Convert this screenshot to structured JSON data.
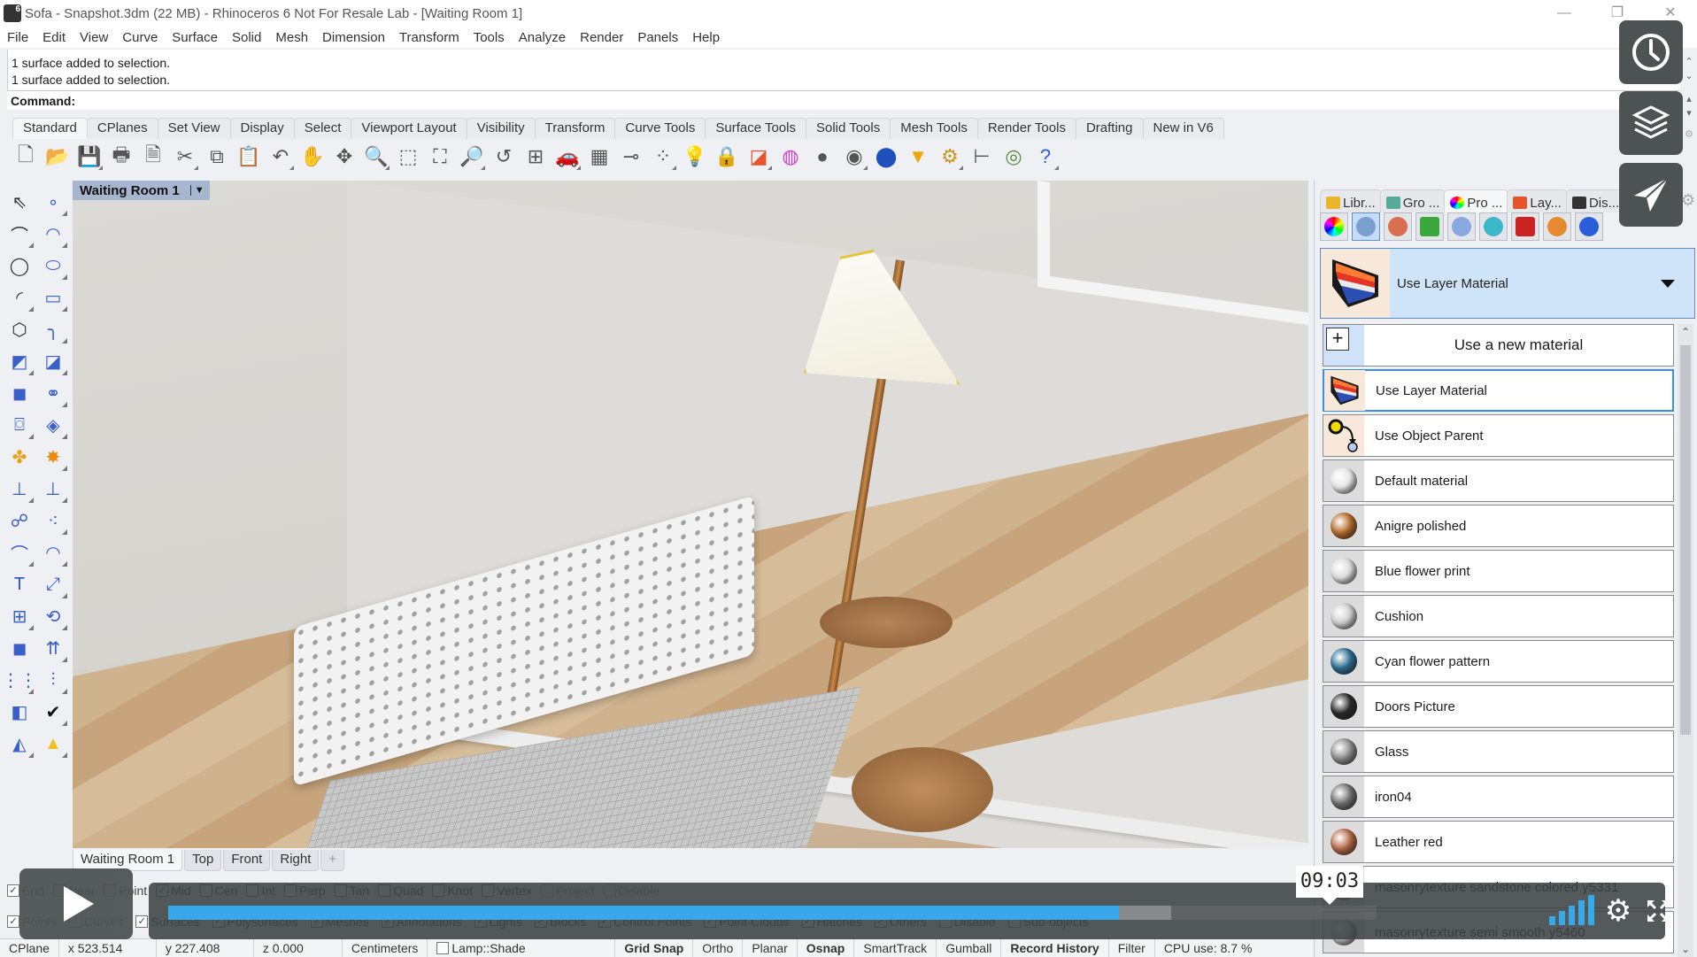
{
  "window": {
    "title": "Sofa - Snapshot.3dm (22 MB) - Rhinoceros 6 Not For Resale Lab - [Waiting Room 1]",
    "controls": [
      "minimize",
      "restore",
      "close"
    ]
  },
  "menu": [
    "File",
    "Edit",
    "View",
    "Curve",
    "Surface",
    "Solid",
    "Mesh",
    "Dimension",
    "Transform",
    "Tools",
    "Analyze",
    "Render",
    "Panels",
    "Help"
  ],
  "command": {
    "history": [
      "1 surface added to selection.",
      "1 surface added to selection."
    ],
    "prompt": "Command:"
  },
  "toolbar_tabs": {
    "items": [
      "Standard",
      "CPlanes",
      "Set View",
      "Display",
      "Select",
      "Viewport Layout",
      "Visibility",
      "Transform",
      "Curve Tools",
      "Surface Tools",
      "Solid Tools",
      "Mesh Tools",
      "Render Tools",
      "Drafting",
      "New in V6"
    ],
    "active": "Standard"
  },
  "standard_tools": [
    "new-file",
    "open",
    "save",
    "print",
    "import",
    "cut",
    "copy",
    "paste",
    "undo",
    "pan",
    "rotate-view",
    "zoom-dynamic",
    "zoom-window",
    "zoom-extents",
    "zoom-selected",
    "undo-view",
    "four-viewports",
    "car-render",
    "grid-options",
    "osnap",
    "select-points",
    "light",
    "lock",
    "layer-material",
    "color-wheel",
    "shade",
    "render-preview",
    "rendered",
    "spotlight",
    "options-gear",
    "dimension",
    "render-globe",
    "help"
  ],
  "left_tools": [
    "select-arrow",
    "point",
    "polyline",
    "curve",
    "circle",
    "ellipse",
    "arc",
    "rectangle",
    "polygon",
    "fillet-curve",
    "surface-corners",
    "extrude-surface",
    "box",
    "spheres",
    "cylinder",
    "mesh-patch",
    "join",
    "explode",
    "trim",
    "split",
    "boolean-union",
    "boolean-group",
    "arc-blend",
    "offset",
    "text",
    "move",
    "array-blocks",
    "rotate",
    "solid-box",
    "extrude-plane",
    "grid-array",
    "mirror",
    "edit-points",
    "check",
    "solid-primitives",
    "pyramid"
  ],
  "viewport": {
    "title": "Waiting Room 1",
    "tabs": [
      "Waiting Room 1",
      "Top",
      "Front",
      "Right"
    ],
    "active_tab": "Waiting Room 1",
    "add_tab_icon": "+"
  },
  "osnap": [
    {
      "label": "End",
      "checked": true
    },
    {
      "label": "Near",
      "checked": false
    },
    {
      "label": "Point",
      "checked": false
    },
    {
      "label": "Mid",
      "checked": true
    },
    {
      "label": "Cen",
      "checked": false
    },
    {
      "label": "Int",
      "checked": false
    },
    {
      "label": "Perp",
      "checked": false
    },
    {
      "label": "Tan",
      "checked": false
    },
    {
      "label": "Quad",
      "checked": false
    },
    {
      "label": "Knot",
      "checked": false
    },
    {
      "label": "Vertex",
      "checked": false
    },
    {
      "label": "Project",
      "checked": false,
      "disabled": true
    },
    {
      "label": "Disable",
      "checked": false,
      "disabled": true
    }
  ],
  "selection_filter": [
    {
      "label": "Points",
      "checked": true
    },
    {
      "label": "Curves",
      "checked": true
    },
    {
      "label": "Surfaces",
      "checked": true
    },
    {
      "label": "Polysurfaces",
      "checked": true
    },
    {
      "label": "Meshes",
      "checked": true
    },
    {
      "label": "Annotations",
      "checked": true
    },
    {
      "label": "Lights",
      "checked": true
    },
    {
      "label": "Blocks",
      "checked": true
    },
    {
      "label": "Control Points",
      "checked": true
    },
    {
      "label": "Point Clouds",
      "checked": true
    },
    {
      "label": "Hatches",
      "checked": true
    },
    {
      "label": "Others",
      "checked": true
    },
    {
      "label": "Disable",
      "checked": false
    },
    {
      "label": "Sub-objects",
      "checked": false
    }
  ],
  "statusbar": {
    "cplane": "CPlane",
    "x": "x 523.514",
    "y": "y 227.408",
    "z": "z 0.000",
    "units": "Centimeters",
    "layer": "Lamp::Shade",
    "toggles": [
      {
        "label": "Grid Snap",
        "on": true
      },
      {
        "label": "Ortho",
        "on": false
      },
      {
        "label": "Planar",
        "on": false
      },
      {
        "label": "Osnap",
        "on": true
      },
      {
        "label": "SmartTrack",
        "on": false
      },
      {
        "label": "Gumball",
        "on": false
      },
      {
        "label": "Record History",
        "on": true
      },
      {
        "label": "Filter",
        "on": false
      }
    ],
    "cpu": "CPU use: 8.7 %"
  },
  "panel": {
    "tabs": [
      "Libr...",
      "Gro ...",
      "Pro ...",
      "Lay...",
      "Dis..."
    ],
    "active_tab": "Pro ...",
    "material_toolbar": [
      "color-wheel",
      "material-brush",
      "texture-decal",
      "texture-map",
      "glass-box",
      "environment-cube",
      "decal-red",
      "sphere-orange",
      "layer-cylinder"
    ],
    "current_material": "Use Layer Material",
    "new_material_label": "Use a new material",
    "materials": [
      {
        "name": "Use Layer Material",
        "selected": true,
        "color": "#f26a2c"
      },
      {
        "name": "Use Object Parent",
        "selected": false,
        "color": "#f5d800"
      },
      {
        "name": "Default material",
        "selected": false,
        "color": "#e6e6e6"
      },
      {
        "name": "Anigre polished",
        "selected": false,
        "color": "#b56c2c"
      },
      {
        "name": "Blue flower print",
        "selected": false,
        "color": "#dcdcdc"
      },
      {
        "name": "Cushion",
        "selected": false,
        "color": "#cfcfcf"
      },
      {
        "name": "Cyan flower pattern",
        "selected": false,
        "color": "#2d6d93"
      },
      {
        "name": "Doors Picture",
        "selected": false,
        "color": "#2a2a2a"
      },
      {
        "name": "Glass",
        "selected": false,
        "color": "#8d8d8d"
      },
      {
        "name": "iron04",
        "selected": false,
        "color": "#707070"
      },
      {
        "name": "Leather red",
        "selected": false,
        "color": "#b46a48"
      },
      {
        "name": "masonrytexture sandstone colored y5331",
        "selected": false,
        "color": "#c9c2b5"
      },
      {
        "name": "masonrytexture semi smooth y5460",
        "selected": false,
        "color": "#b9b9b9"
      }
    ]
  },
  "video_player": {
    "time_tooltip": "09:03",
    "played_fraction": 0.787,
    "loaded_fraction": 0.83,
    "volume_bars": 5,
    "side_buttons": [
      "clock-icon",
      "layers-icon",
      "send-icon"
    ]
  }
}
